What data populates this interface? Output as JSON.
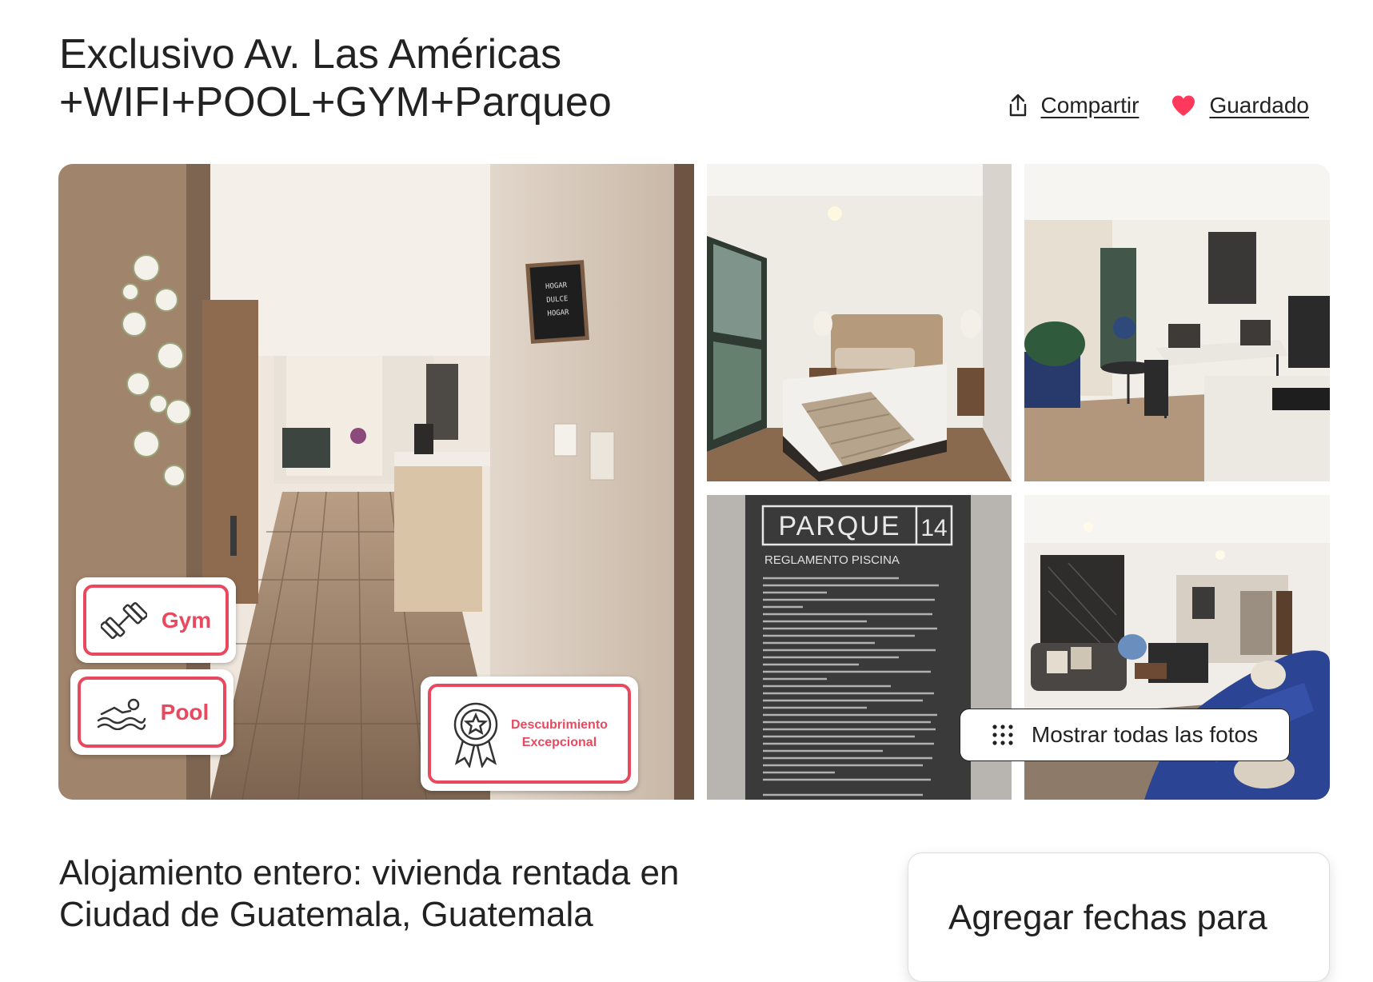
{
  "listing": {
    "title_line1": "Exclusivo Av. Las Américas",
    "title_line2": "+WIFI+POOL+GYM+Parqueo",
    "share_label": "Compartir",
    "saved_label": "Guardado"
  },
  "gallery": {
    "show_all_label": "Mostrar todas las fotos",
    "badges": {
      "gym": "Gym",
      "pool": "Pool",
      "discovery_line1": "Descubrimiento",
      "discovery_line2": "Excepcional"
    },
    "sign": {
      "brand": "PARQUE",
      "number": "14",
      "heading": "REGLAMENTO PISCINA"
    },
    "letterboard": [
      "HOGAR",
      "DULCE",
      "HOGAR"
    ]
  },
  "details": {
    "subtitle_line1": "Alojamiento entero: vivienda rentada en",
    "subtitle_line2": "Ciudad de Guatemala, Guatemala"
  },
  "booking": {
    "prompt": "Agregar fechas para"
  },
  "colors": {
    "accent": "#e8495f",
    "heart": "#ff385c",
    "text": "#222222"
  },
  "icons": {
    "share": "share-icon",
    "saved": "heart-icon",
    "show_all": "grid-dots-icon"
  }
}
